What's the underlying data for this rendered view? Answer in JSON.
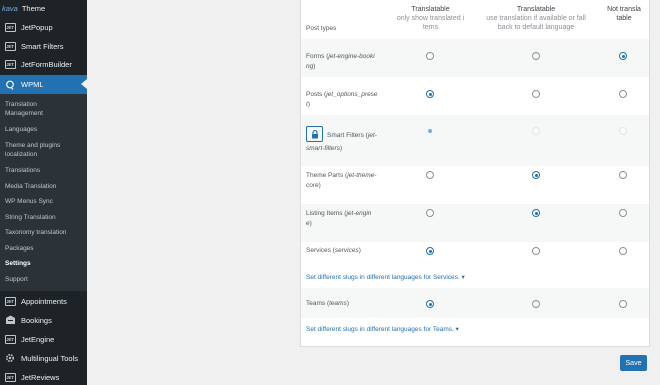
{
  "sidebar": {
    "theme_prefix": "kava",
    "theme_label": "Theme",
    "top_items": [
      {
        "label": "JetPopup",
        "icon": "jet-icon",
        "icon_text": "JET"
      },
      {
        "label": "Smart Filters",
        "icon": "jet-icon",
        "icon_text": "JET"
      },
      {
        "label": "JetFormBuilder",
        "icon": "jet-icon",
        "icon_text": "JET"
      }
    ],
    "wpml_label": "WPML",
    "submenu": [
      {
        "label": "Translation Management",
        "line1": "Translation",
        "line2": "Management"
      },
      {
        "label": "Languages"
      },
      {
        "label": "Theme and plugins localization",
        "line1": "Theme and plugins",
        "line2": "localization"
      },
      {
        "label": "Translations"
      },
      {
        "label": "Media Translation"
      },
      {
        "label": "WP Menus Sync"
      },
      {
        "label": "String Translation"
      },
      {
        "label": "Taxonomy translation"
      },
      {
        "label": "Packages"
      },
      {
        "label": "Settings"
      },
      {
        "label": "Support"
      }
    ],
    "bottom_items": [
      {
        "label": "Appointments",
        "icon": "jet-icon",
        "icon_text": "JET"
      },
      {
        "label": "Bookings",
        "icon": "bookings-icon"
      },
      {
        "label": "JetEngine",
        "icon": "jet-icon",
        "icon_text": "JET"
      },
      {
        "label": "Multilingual Tools",
        "icon": "gear-icon"
      },
      {
        "label": "JetReviews",
        "icon": "jet-icon",
        "icon_text": "JET"
      }
    ]
  },
  "table": {
    "post_types_header": "Post types",
    "col1": {
      "title": "Translatable",
      "sub1": "only show translated i",
      "sub2": "tems"
    },
    "col2": {
      "title": "Translatable",
      "sub1": "use translation if available or fall",
      "sub2": "back to default language"
    },
    "col3": {
      "title1": "Not transla",
      "title2": "table"
    },
    "rows": [
      {
        "name1": "Forms (",
        "slug1": "jet-engine-booki",
        "slug2": "ng",
        "end": ")",
        "selected": 3
      },
      {
        "name1": "Posts (",
        "slug1": "jet_options_prese",
        "slug2": "t",
        "end": ")",
        "selected": 1
      },
      {
        "name1": "Smart Filters (",
        "slug1": "jet-",
        "slug2": "smart-filters",
        "end": ")",
        "selected": 1,
        "locked": true
      },
      {
        "name1": "Theme Parts (",
        "slug1": "jet-theme-",
        "slug2": "core",
        "end": ")",
        "selected": 2
      },
      {
        "name1": "Listing Items (",
        "slug1": "jet-engin",
        "slug2": "e",
        "end": ")",
        "selected": 2
      },
      {
        "name1": "Services (",
        "slug1": "services",
        "end": ")",
        "selected": 1,
        "link": "Set different slugs in different languages for Services. ▾"
      },
      {
        "name1": "Teams (",
        "slug1": "teams",
        "end": ")",
        "selected": 1,
        "link": "Set different slugs in different languages for Teams. ▾"
      }
    ]
  },
  "save_label": "Save",
  "colors": {
    "accent": "#2271b1",
    "sidebar": "#1d2327",
    "submenu": "#2c3338"
  }
}
